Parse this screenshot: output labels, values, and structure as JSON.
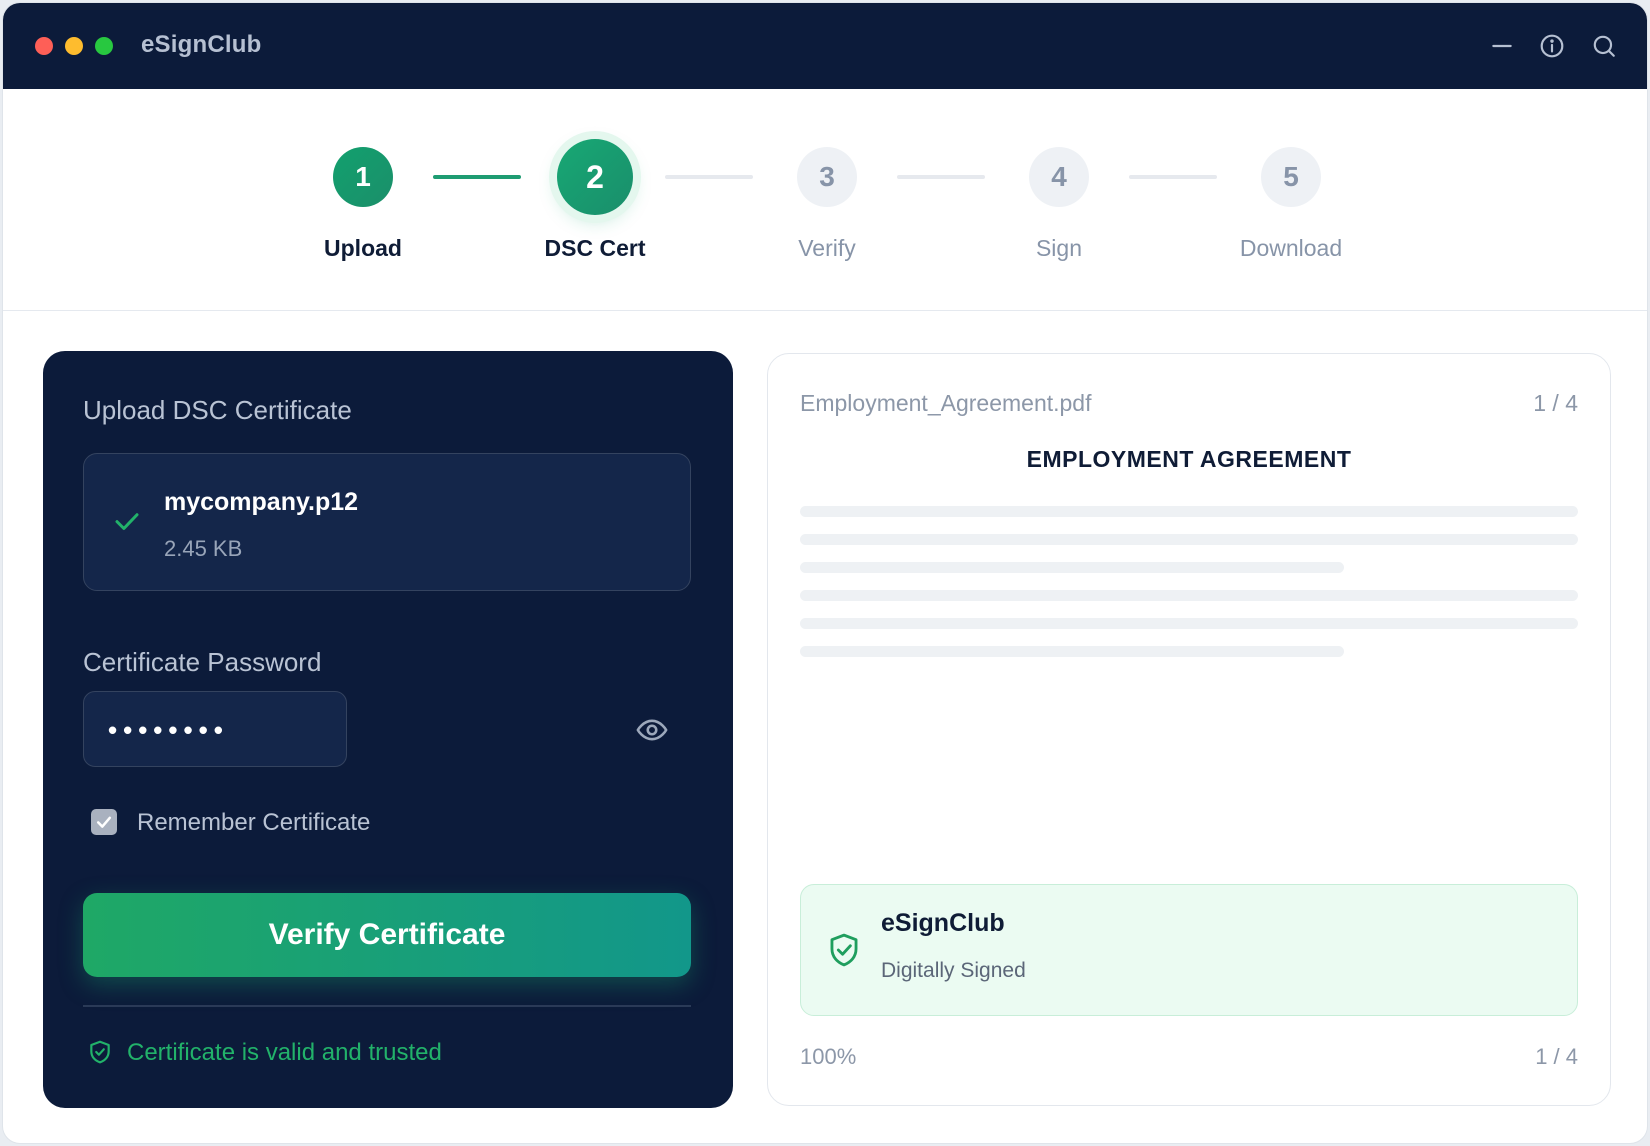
{
  "app": {
    "title": "eSignClub"
  },
  "steps": [
    {
      "number": "1",
      "label": "Upload",
      "state": "done"
    },
    {
      "number": "2",
      "label": "DSC Cert",
      "state": "active"
    },
    {
      "number": "3",
      "label": "Verify",
      "state": "todo"
    },
    {
      "number": "4",
      "label": "Sign",
      "state": "todo"
    },
    {
      "number": "5",
      "label": "Download",
      "state": "todo"
    }
  ],
  "certificate_panel": {
    "title": "Upload DSC Certificate",
    "file": {
      "name": "mycompany.p12",
      "size": "2.45 KB"
    },
    "password_label": "Certificate Password",
    "password_value": "••••••••",
    "remember_label": "Remember Certificate",
    "remember_checked": true,
    "verify_button": "Verify Certificate",
    "status_text": "Certificate is valid and trusted"
  },
  "preview": {
    "filename": "Employment_Agreement.pdf",
    "page_indicator": "1 / 4",
    "document_title": "EMPLOYMENT AGREEMENT",
    "signature": {
      "name": "eSignClub",
      "status": "Digitally Signed"
    },
    "zoom": "100%",
    "page_indicator_bottom": "1 / 4"
  },
  "colors": {
    "titlebar": "#0c1b3a",
    "accent_green": "#1fa866",
    "panel_dark": "#0c1b3a",
    "valid_green": "#22b26a"
  },
  "icons": {
    "window_controls": [
      "close",
      "minimize",
      "maximize"
    ],
    "toolbar": [
      "minimize-icon",
      "info-icon",
      "search-icon"
    ],
    "file_status": "check-icon",
    "password_toggle": "eye-icon",
    "valid_status": "shield-check-icon",
    "signature": "shield-check-icon"
  }
}
